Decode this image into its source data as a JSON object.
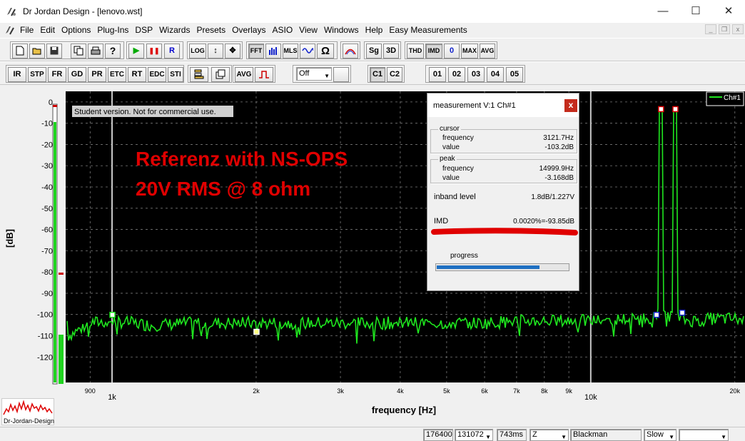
{
  "window": {
    "title": "Dr Jordan Design - [lenovo.wst]",
    "minimize": "—",
    "maximize": "☐",
    "close": "✕"
  },
  "menu": [
    "File",
    "Edit",
    "Options",
    "Plug-Ins",
    "DSP",
    "Wizards",
    "Presets",
    "Overlays",
    "ASIO",
    "View",
    "Windows",
    "Help",
    "Easy Measurements"
  ],
  "toolbar1": {
    "log": "LOG",
    "fft": "FFT",
    "mls": "MLS",
    "sg": "Sg",
    "three_d": "3D",
    "thd": "THD",
    "imd": "IMD",
    "zero": "0",
    "max": "MAX",
    "avg": "AVG",
    "run": "▶",
    "pause": "❚❚",
    "record": "R",
    "ohm": "Ω"
  },
  "toolbar2": {
    "ir": "IR",
    "stp": "STP",
    "fr": "FR",
    "gd": "GD",
    "pr": "PR",
    "etc": "ETC",
    "rt": "RT",
    "edc": "EDC",
    "sti": "STI",
    "avg": "AVG",
    "mode_select": "Off",
    "c1": "C1",
    "c2": "C2",
    "presets": [
      "01",
      "02",
      "03",
      "04",
      "05"
    ]
  },
  "plot": {
    "watermark": "Student version. Not for commercial use.",
    "annotation_line1": "Referenz with NS-OPS",
    "annotation_line2": "20V RMS @ 8 ohm",
    "ylabel": "[dB]",
    "xlabel": "frequency [Hz]",
    "legend": "Ch#1",
    "trace_color": "#1fe61f",
    "annotation_color": "#e00000",
    "y_ticks": [
      "0",
      "-10",
      "-20",
      "-30",
      "-40",
      "-50",
      "-60",
      "-70",
      "-80",
      "-90",
      "-100",
      "-110",
      "-120"
    ],
    "x_ticks": [
      "900",
      "1k",
      "2k",
      "3k",
      "4k",
      "5k",
      "6k",
      "7k",
      "8k",
      "9k",
      "10k",
      "20k"
    ]
  },
  "chart_data": {
    "type": "line",
    "x_scale": "log",
    "xlim": [
      800,
      21000
    ],
    "ylim": [
      -132,
      5
    ],
    "series": [
      {
        "name": "Ch#1",
        "points": [
          [
            810,
            -110
          ],
          [
            900,
            -104
          ],
          [
            1000,
            -103
          ],
          [
            1200,
            -105
          ],
          [
            1500,
            -104
          ],
          [
            2000,
            -104
          ],
          [
            3000,
            -104
          ],
          [
            4000,
            -104
          ],
          [
            5000,
            -104
          ],
          [
            6000,
            -104
          ],
          [
            7000,
            -103
          ],
          [
            8000,
            -103
          ],
          [
            9000,
            -103
          ],
          [
            10000,
            -103
          ],
          [
            12000,
            -102
          ],
          [
            13000,
            -102
          ],
          [
            13900,
            -100
          ],
          [
            14000,
            -3.2
          ],
          [
            14100,
            -101
          ],
          [
            14900,
            -100
          ],
          [
            15000,
            -3.2
          ],
          [
            15100,
            -101
          ],
          [
            16000,
            -103
          ],
          [
            18000,
            -102
          ],
          [
            20000,
            -102
          ],
          [
            21000,
            -103
          ]
        ]
      }
    ],
    "markers": [
      {
        "x": 1000,
        "y": -100
      },
      {
        "x": 2000,
        "y": -108
      },
      {
        "x": 14000,
        "y": -3.2
      },
      {
        "x": 15000,
        "y": -3.2
      },
      {
        "x": 13700,
        "y": -100
      },
      {
        "x": 15500,
        "y": -99
      }
    ]
  },
  "measurement": {
    "title": "measurement V:1 Ch#1",
    "close": "x",
    "cursor_label": "cursor",
    "peak_label": "peak",
    "frequency_label": "frequency",
    "value_label": "value",
    "cursor_frequency": "3121.7Hz",
    "cursor_value": "-103.2dB",
    "peak_frequency": "14999.9Hz",
    "peak_value": "-3.168dB",
    "inband_label": "inband level",
    "inband_value": "1.8dB/1.227V",
    "imd_label": "IMD",
    "imd_value": "0.0020%=-93.85dB",
    "progress_label": "progress",
    "progress": 0.78
  },
  "logo_text": "Dr-Jordan-Design",
  "status": {
    "samplerate": "176400",
    "fftsize": "131072",
    "duration": "743ms",
    "weighting": "Z",
    "window": "Blackman",
    "speed": "Slow",
    "extra": ""
  }
}
